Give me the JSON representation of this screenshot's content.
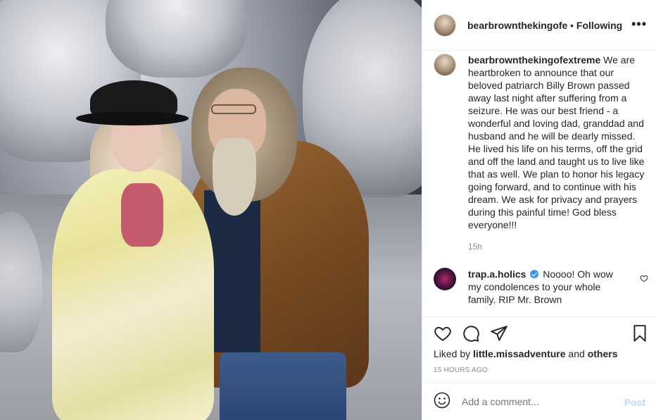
{
  "photo": {
    "description_icon": "photo"
  },
  "header": {
    "username": "bearbrownthekingofextreme",
    "separator": "•",
    "follow_status": "Following",
    "more": "•••"
  },
  "caption": {
    "username": "bearbrownthekingofextreme",
    "text": " We are heartbroken to announce that our beloved patriarch Billy Brown passed away last night after suffering from a seizure. He was our best friend - a wonderful and loving dad, granddad and husband and he will be dearly missed.  He lived his life on his terms, off the grid and off the land and taught us to live like that as well. We plan to honor his legacy going forward, and to continue with his dream.  We ask for privacy and prayers during this painful time! God bless everyone!!!",
    "time": "15h"
  },
  "comment": {
    "username": "trap.a.holics",
    "text": " Noooo! Oh wow my condolences to your whole family. RIP Mr. Brown"
  },
  "actions": {
    "icons": [
      "heart-icon",
      "comment-icon",
      "share-icon",
      "bookmark-icon"
    ]
  },
  "likes": {
    "prefix": "Liked by ",
    "user": "little.missadventure",
    "middle": " and ",
    "others": "others"
  },
  "timeago": "15 HOURS AGO",
  "add_comment": {
    "placeholder": "Add a comment...",
    "post_label": "Post"
  },
  "colors": {
    "text": "#262626",
    "muted": "#8e8e8e",
    "verified": "#3897f0",
    "post_disabled": "#b2dffc",
    "divider": "#efefef"
  }
}
